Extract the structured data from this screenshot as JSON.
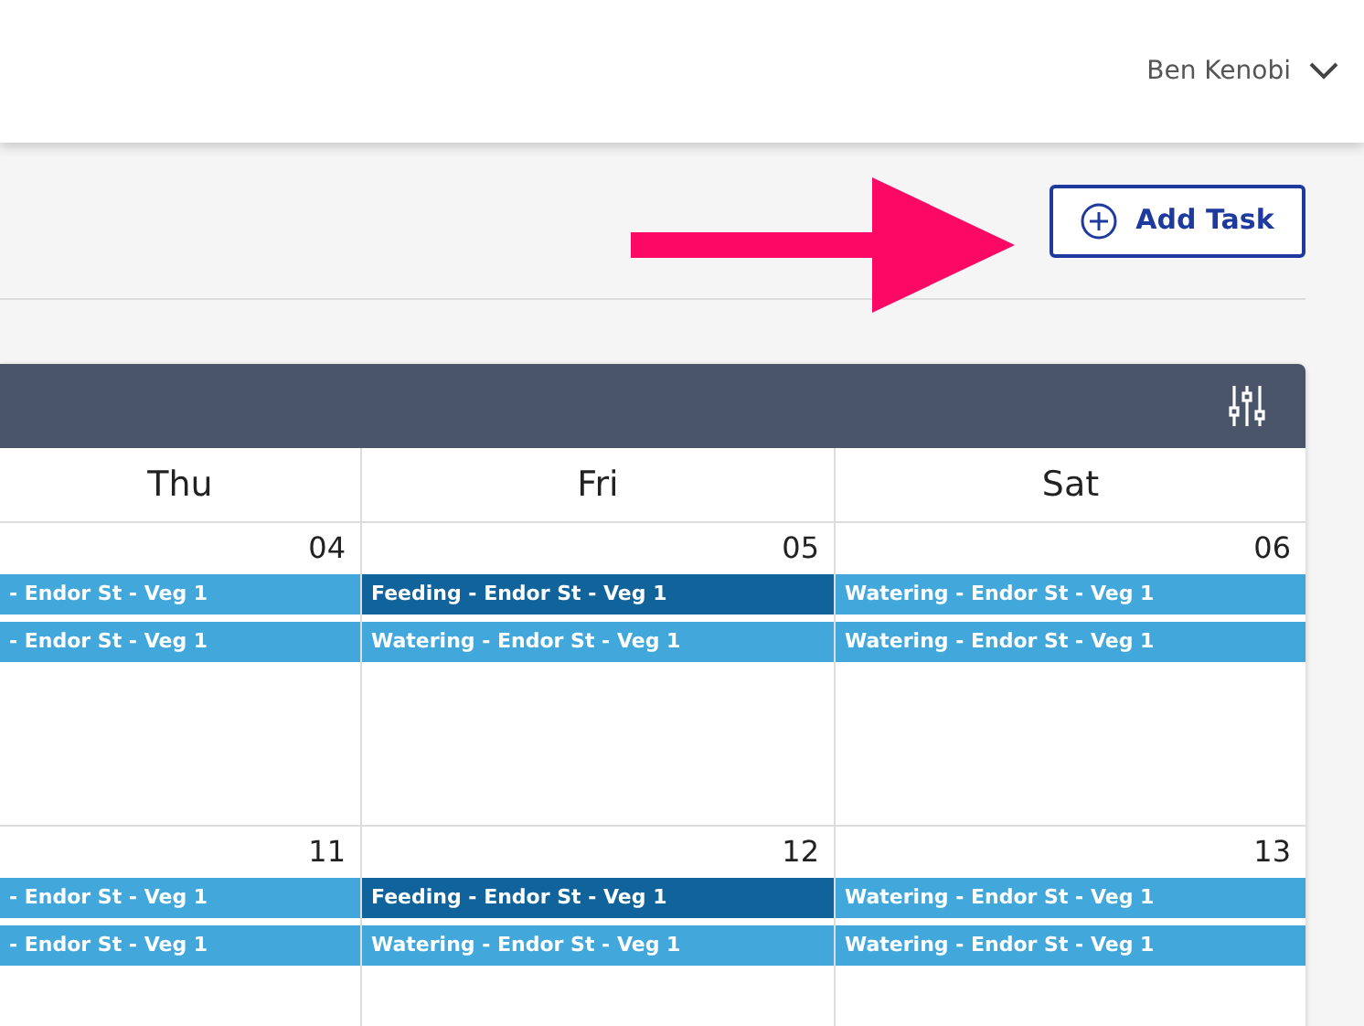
{
  "header": {
    "user": "Ben Kenobi"
  },
  "toolbar": {
    "add_button": "Add Task"
  },
  "calendar": {
    "days": [
      "Thu",
      "Fri",
      "Sat"
    ],
    "weeks": [
      {
        "cells": [
          {
            "date": "04",
            "events": [
              {
                "label": "- Endor St - Veg 1",
                "color": "#42a8db"
              },
              {
                "label": "- Endor St - Veg 1",
                "color": "#42a8db"
              }
            ]
          },
          {
            "date": "05",
            "events": [
              {
                "label": "Feeding - Endor St - Veg 1",
                "color": "#10649b"
              },
              {
                "label": "Watering - Endor St - Veg 1",
                "color": "#42a8db"
              }
            ]
          },
          {
            "date": "06",
            "events": [
              {
                "label": "Watering - Endor St - Veg 1",
                "color": "#42a8db"
              },
              {
                "label": "Watering - Endor St - Veg 1",
                "color": "#42a8db"
              }
            ]
          }
        ]
      },
      {
        "cells": [
          {
            "date": "11",
            "events": [
              {
                "label": "- Endor St - Veg 1",
                "color": "#42a8db"
              },
              {
                "label": "- Endor St - Veg 1",
                "color": "#42a8db"
              }
            ]
          },
          {
            "date": "12",
            "events": [
              {
                "label": "Feeding - Endor St - Veg 1",
                "color": "#10649b"
              },
              {
                "label": "Watering - Endor St - Veg 1",
                "color": "#42a8db"
              }
            ]
          },
          {
            "date": "13",
            "events": [
              {
                "label": "Watering - Endor St - Veg 1",
                "color": "#42a8db"
              },
              {
                "label": "Watering - Endor St - Veg 1",
                "color": "#42a8db"
              }
            ]
          }
        ]
      }
    ]
  }
}
